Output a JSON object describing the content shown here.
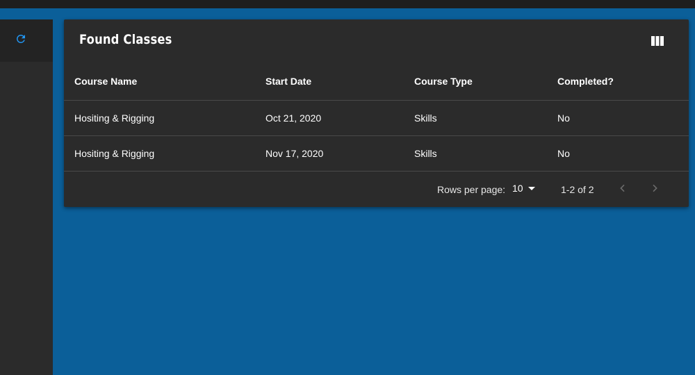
{
  "card": {
    "title": "Found Classes"
  },
  "table": {
    "headers": [
      "Course Name",
      "Start Date",
      "Course Type",
      "Completed?"
    ],
    "rows": [
      [
        "Hositing & Rigging",
        "Oct 21, 2020",
        "Skills",
        "No"
      ],
      [
        "Hositing & Rigging",
        "Nov 17, 2020",
        "Skills",
        "No"
      ]
    ]
  },
  "pagination": {
    "rows_per_page_label": "Rows per page:",
    "rows_per_page_value": "10",
    "range_text": "1-2 of 2"
  },
  "icons": {
    "refresh": "refresh-icon",
    "columns": "view-column-icon",
    "caret": "arrow-drop-down-icon",
    "prev": "chevron-left-icon",
    "next": "chevron-right-icon"
  },
  "colors": {
    "background": "#0b5f99",
    "surface": "#2b2b2b",
    "accent": "#2196f3",
    "divider": "#4a4a4a"
  }
}
